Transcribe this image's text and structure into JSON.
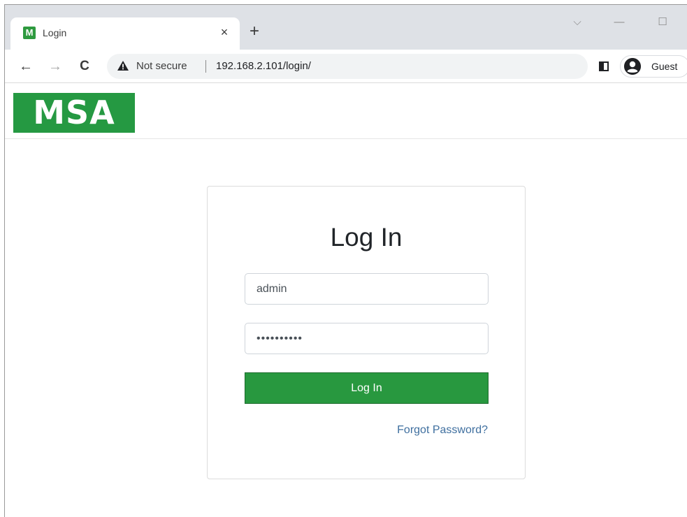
{
  "browser": {
    "tab": {
      "favicon_letter": "M",
      "title": "Login",
      "close_glyph": "×"
    },
    "new_tab_glyph": "+",
    "window_controls": {
      "tab_search_glyph": "⌵",
      "minimize_glyph": "—",
      "maximize_glyph": "☐"
    },
    "toolbar": {
      "back_glyph": "←",
      "forward_glyph": "→",
      "reload_glyph": "C",
      "security_label": "Not secure",
      "url": "192.168.2.101/login/",
      "profile_label": "Guest"
    },
    "icons": [
      "warning-icon",
      "side-panel-icon",
      "profile-avatar-icon"
    ]
  },
  "site": {
    "logo_text": "MSA",
    "logo_color": "#259942"
  },
  "login": {
    "heading": "Log In",
    "username_value": "admin",
    "password_value": "••••••••••",
    "submit_label": "Log In",
    "forgot_label": "Forgot Password?",
    "button_color": "#28983f",
    "link_color": "#3f6f9f"
  }
}
